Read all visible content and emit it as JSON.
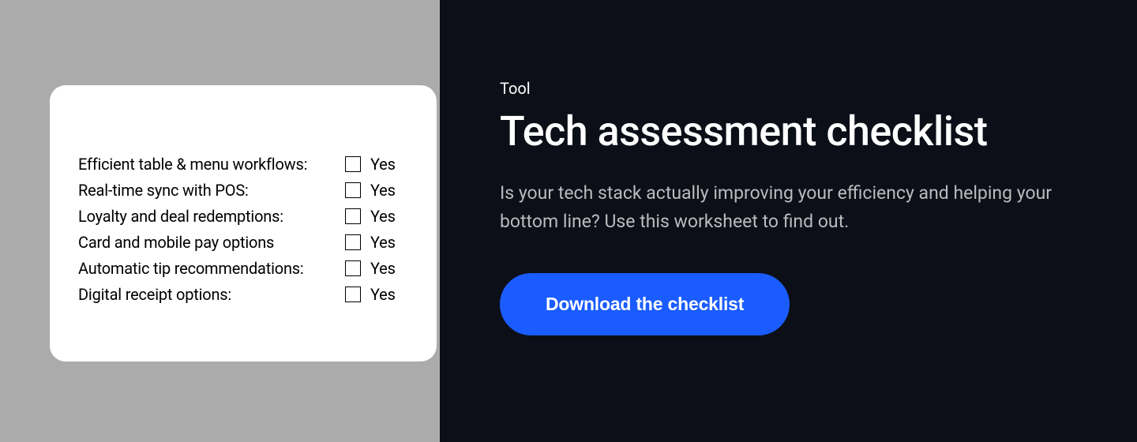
{
  "checklist": {
    "items": [
      {
        "label": "Efficient table & menu workflows:",
        "answer": "Yes"
      },
      {
        "label": "Real-time sync with POS:",
        "answer": "Yes"
      },
      {
        "label": "Loyalty and deal redemptions:",
        "answer": "Yes"
      },
      {
        "label": "Card and mobile pay options",
        "answer": "Yes"
      },
      {
        "label": "Automatic tip recommendations:",
        "answer": "Yes"
      },
      {
        "label": "Digital receipt options:",
        "answer": "Yes"
      }
    ]
  },
  "content": {
    "eyebrow": "Tool",
    "title": "Tech assessment checklist",
    "description": "Is your tech stack actually improving your efficiency and helping your bottom line? Use this worksheet to find out.",
    "cta_label": "Download the checklist"
  }
}
